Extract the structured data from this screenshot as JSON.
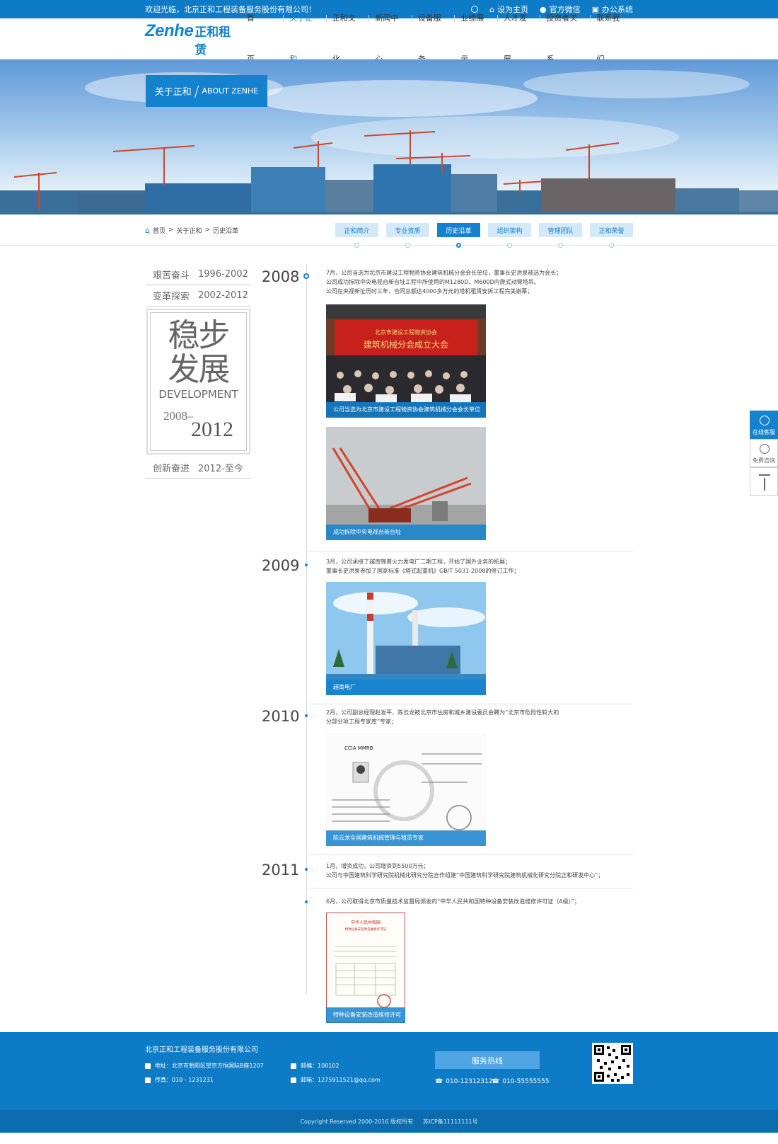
{
  "topbar": {
    "welcome": "欢迎光临，北京正和工程装备服务股份有限公司！",
    "links": [
      "设为主页",
      "官方微信",
      "办公系统"
    ]
  },
  "logo": {
    "en": "Zenhe",
    "cn": "正和租赁"
  },
  "nav": [
    "首　　页",
    "关于正和",
    "正和文化",
    "新闻中心",
    "设备服务",
    "业绩展示",
    "人才发展",
    "投资者关系",
    "联系我们"
  ],
  "banner": {
    "cn": "关于正和",
    "en": "ABOUT ZENHE"
  },
  "breadcrumb": [
    "首页",
    "关于正和",
    "历史沿革"
  ],
  "tabs": [
    "正和简介",
    "专业资质",
    "历史沿革",
    "组织架构",
    "管理团队",
    "正和荣誉"
  ],
  "eras": {
    "first": {
      "name": "艰苦奋斗",
      "years": "1996-2002"
    },
    "second": {
      "name": "变革探索",
      "years": "2002-2012"
    },
    "current": {
      "title": "稳步发展",
      "title_line1": "稳步",
      "title_line2": "发展",
      "en": "DEVELOPMENT",
      "from": "2008–",
      "to": "2012"
    },
    "last": {
      "name": "创新奋进",
      "years": "2012-至今"
    }
  },
  "timeline": [
    {
      "year": "2008",
      "lines": [
        "7月，公司当选为北京市建设工程物资协会建筑机械分会会长单位，董事长史洪泉被选为会长；",
        "公司成功拆除中央电视台新台址工程中所使用的M1280D、M600D内爬式动臂塔吊。",
        "公司在央视新址历时三年，合同总额达4000多万元的塔机租赁安拆工程完美谢幕；"
      ],
      "photos": [
        {
          "caption": "公司当选为北京市建设工程物资协会建筑机械分会会长单位",
          "banner_text": "北京市建设工程物资协会",
          "banner_text2": "建筑机械分会成立大会"
        },
        {
          "caption": "成功拆除中央电视台新台址"
        }
      ]
    },
    {
      "year": "2009",
      "lines": [
        "3月，公司承接了越南锦普火力发电厂二期工程，开始了国外业务的拓展；",
        "董事长史洪泉参加了国家标准《塔式起重机》GB/T 5031-2008的修订工作；"
      ],
      "photos": [
        {
          "caption": "越南电厂"
        }
      ]
    },
    {
      "year": "2010",
      "lines": [
        "2月，公司副总经理赵发平、陈云龙被北京市住房和城乡建设委员会聘为“北京市危险性较大的",
        "分部分项工程专家库”专家；"
      ],
      "photos": [
        {
          "caption": "陈云龙全国建筑机械管理与租赁专家",
          "cert_header": "CCIA MMRB"
        }
      ]
    },
    {
      "year": "2011",
      "lines": [
        "1月，增资成功，公司增资到5500万元；",
        "公司与中国建筑科学研究院机械化研究分院合作组建“中国建筑科学研究院建筑机械化研究分院正和研发中心”；"
      ],
      "sub": {
        "lines": [
          "6月，公司取得北京市质量技术监督局颁发的“中华人民共和国特种设备安装改造维修许可证（A级）”；"
        ],
        "photos": [
          {
            "caption": "特种设备安装改造维修许可证",
            "cert_title": "中华人民共和国",
            "cert_title2": "特种设备安装改造维修许可证"
          }
        ]
      }
    }
  ],
  "side": [
    "在线客服",
    "免费咨询"
  ],
  "footer": {
    "company": "北京正和工程装备服务股份有限公司",
    "address": "地址：北京市朝阳区望京方恒国际B座1207",
    "fax": "传真：010 - 1231231",
    "postcode": "邮编：100102",
    "email": "邮箱：1275911521@qq.com",
    "hotline": "服务热线",
    "phone1": "010-12312312",
    "phone2": "010-55555555",
    "copyright": "Copyright Reserved 2000-2016 版权所有",
    "icp": "苏ICP备11111111号"
  },
  "colors": {
    "primary": "#1482cf",
    "topbar": "#0e7bc6",
    "tab_light": "#d4e9f7"
  }
}
